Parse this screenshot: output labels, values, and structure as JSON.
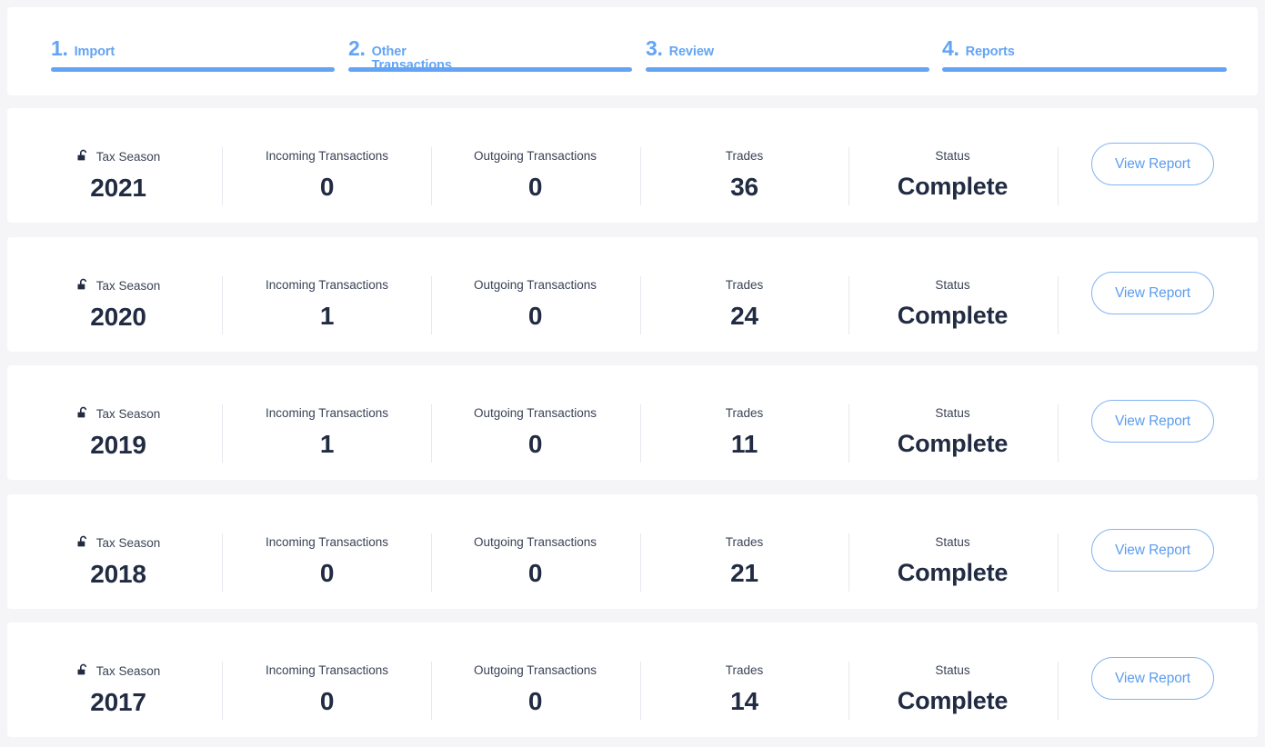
{
  "theme": {
    "page_bg": "#f5f5f8",
    "card_bg": "#ffffff",
    "accent_blue": "#63a4f4",
    "button_blue": "#5b9cf0",
    "button_border": "#82b4f2",
    "text_dark": "#212b42",
    "label_gray": "#3a4356",
    "divider": "#e6e8f0"
  },
  "stepper": {
    "steps": [
      {
        "number": "1.",
        "label": "Import"
      },
      {
        "number": "2.",
        "label": "Other Transactions"
      },
      {
        "number": "3.",
        "label": "Review"
      },
      {
        "number": "4.",
        "label": "Reports"
      }
    ]
  },
  "columns": {
    "tax_season": "Tax Season",
    "incoming": "Incoming Transactions",
    "outgoing": "Outgoing Transactions",
    "trades": "Trades",
    "status": "Status"
  },
  "icons": {
    "tax_season": "unlock-icon"
  },
  "action": {
    "view_report": "View Report"
  },
  "rows": [
    {
      "tax_season": "2021",
      "incoming": "0",
      "outgoing": "0",
      "trades": "36",
      "status": "Complete"
    },
    {
      "tax_season": "2020",
      "incoming": "1",
      "outgoing": "0",
      "trades": "24",
      "status": "Complete"
    },
    {
      "tax_season": "2019",
      "incoming": "1",
      "outgoing": "0",
      "trades": "11",
      "status": "Complete"
    },
    {
      "tax_season": "2018",
      "incoming": "0",
      "outgoing": "0",
      "trades": "21",
      "status": "Complete"
    },
    {
      "tax_season": "2017",
      "incoming": "0",
      "outgoing": "0",
      "trades": "14",
      "status": "Complete"
    }
  ]
}
